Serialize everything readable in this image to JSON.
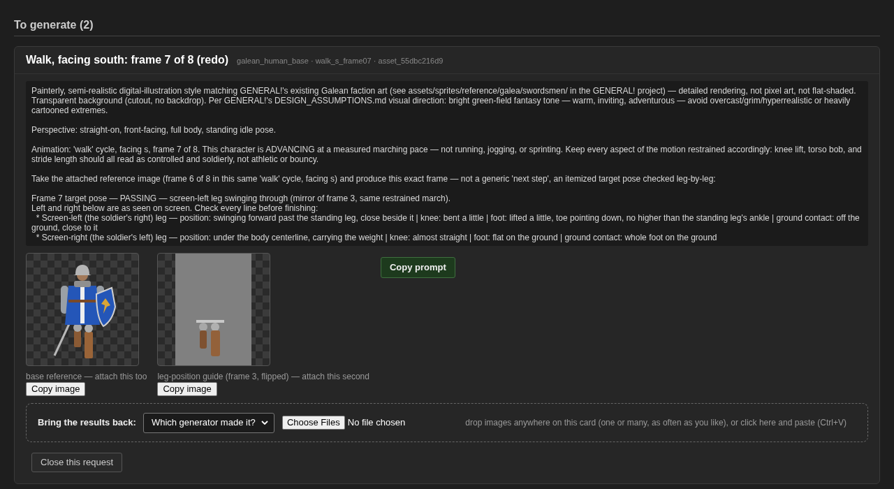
{
  "section": {
    "title": "To generate (2)"
  },
  "request": {
    "title": "Walk, facing south: frame 7 of 8 (redo)",
    "meta": "galean_human_base · walk_s_frame07 · asset_55dbc216d9",
    "prompt": {
      "paragraphs": [
        [
          "Painterly, semi-realistic digital-illustration style matching GENERAL!'s existing Galean faction art (see assets/sprites/reference/galea/swordsmen/ in the GENERAL! project) — detailed rendering, not pixel art, not flat-shaded. Transparent background (cutout, no backdrop). Per GENERAL!'s DESIGN_ASSUMPTIONS.md visual direction: bright green-field fantasy tone — warm, inviting, adventurous — avoid overcast/grim/hyperrealistic or heavily cartooned extremes."
        ],
        [
          "Perspective: straight-on, front-facing, full body, standing idle pose."
        ],
        [
          "Animation: 'walk' cycle, facing s, frame 7 of 8. This character is ADVANCING at a measured marching pace — not running, jogging, or sprinting. Keep every aspect of the motion restrained accordingly: knee lift, torso bob, and stride length should all read as controlled and soldierly, not athletic or bouncy."
        ],
        [
          "Take the attached reference image (frame 6 of 8 in this same 'walk' cycle, facing s) and produce this exact frame — not a generic 'next step', an itemized target pose checked leg-by-leg:"
        ],
        [
          "Frame 7 target pose — PASSING — screen-left leg swinging through (mirror of frame 3, same restrained march).",
          "Left and right below are as seen on screen. Check every line before finishing:",
          "  * Screen-left (the soldier's right) leg — position: swinging forward past the standing leg, close beside it | knee: bent a little | foot: lifted a little, toe pointing down, no higher than the standing leg's ankle | ground contact: off the ground, close to it",
          "  * Screen-right (the soldier's left) leg — position: under the body centerline, carrying the weight | knee: almost straight | foot: flat on the ground | ground contact: whole foot on the ground"
        ]
      ]
    },
    "images": [
      {
        "kind": "knight",
        "caption": "base reference — attach this too",
        "button": "Copy image"
      },
      {
        "kind": "leg_guide",
        "caption": "leg-position guide (frame 3, flipped) — attach this second",
        "button": "Copy image"
      }
    ],
    "copy_prompt_button": "Copy prompt",
    "results": {
      "label": "Bring the results back:",
      "generator_select": "Which generator made it?",
      "file_button": "Choose Files",
      "file_status": "No file chosen",
      "hint": "drop images anywhere on this card (one or many, as often as you like), or click here and paste (Ctrl+V)"
    },
    "close_button": "Close this request"
  }
}
